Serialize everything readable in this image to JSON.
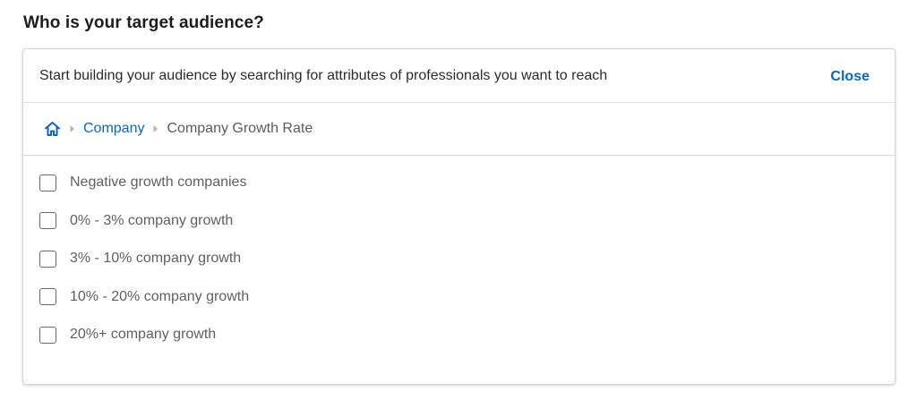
{
  "section": {
    "title": "Who is your target audience?"
  },
  "panel": {
    "prompt": "Start building your audience by searching for attributes of professionals you want to reach",
    "close_label": "Close"
  },
  "breadcrumb": {
    "home_icon": "home-icon",
    "items": [
      {
        "label": "Company",
        "link": true
      },
      {
        "label": "Company Growth Rate",
        "link": false
      }
    ]
  },
  "options": [
    {
      "label": "Negative growth companies",
      "checked": false
    },
    {
      "label": "0% - 3% company growth",
      "checked": false
    },
    {
      "label": "3% - 10% company growth",
      "checked": false
    },
    {
      "label": "10% - 20% company growth",
      "checked": false
    },
    {
      "label": "20%+ company growth",
      "checked": false
    }
  ],
  "colors": {
    "accent": "#0a66c2",
    "text_primary": "#1d1d1d",
    "text_secondary": "#5f5f5f",
    "border": "#d6d6d6"
  }
}
